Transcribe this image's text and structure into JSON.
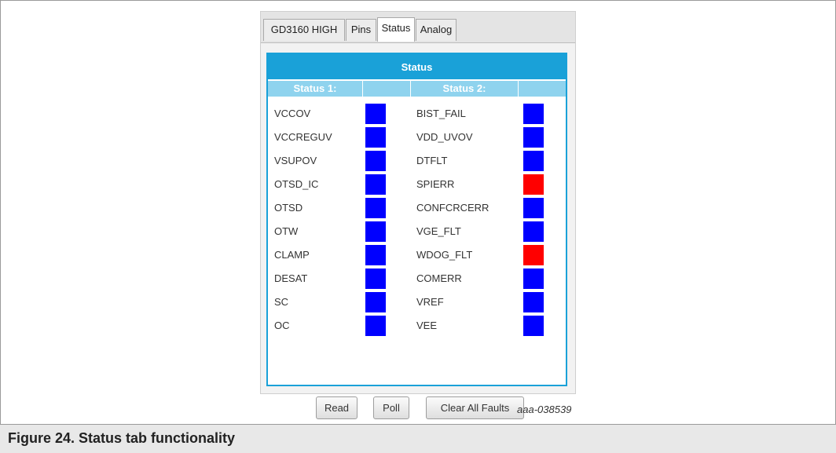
{
  "tabs": [
    {
      "label": "GD3160 HIGH",
      "active": false
    },
    {
      "label": "Pins",
      "active": false
    },
    {
      "label": "Status",
      "active": true
    },
    {
      "label": "Analog",
      "active": false
    }
  ],
  "panel": {
    "title": "Status",
    "col1_header": "Status 1:",
    "col2_header": "Status 2:"
  },
  "status1": [
    {
      "label": "VCCOV",
      "state": "blue"
    },
    {
      "label": "VCCREGUV",
      "state": "blue"
    },
    {
      "label": "VSUPOV",
      "state": "blue"
    },
    {
      "label": "OTSD_IC",
      "state": "blue"
    },
    {
      "label": "OTSD",
      "state": "blue"
    },
    {
      "label": "OTW",
      "state": "blue"
    },
    {
      "label": "CLAMP",
      "state": "blue"
    },
    {
      "label": "DESAT",
      "state": "blue"
    },
    {
      "label": "SC",
      "state": "blue"
    },
    {
      "label": "OC",
      "state": "blue"
    }
  ],
  "status2": [
    {
      "label": "BIST_FAIL",
      "state": "blue"
    },
    {
      "label": "VDD_UVOV",
      "state": "blue"
    },
    {
      "label": "DTFLT",
      "state": "blue"
    },
    {
      "label": "SPIERR",
      "state": "red"
    },
    {
      "label": "CONFCRCERR",
      "state": "blue"
    },
    {
      "label": "VGE_FLT",
      "state": "blue"
    },
    {
      "label": "WDOG_FLT",
      "state": "red"
    },
    {
      "label": "COMERR",
      "state": "blue"
    },
    {
      "label": "VREF",
      "state": "blue"
    },
    {
      "label": "VEE",
      "state": "blue"
    }
  ],
  "buttons": {
    "read": "Read",
    "poll": "Poll",
    "clear": "Clear All Faults"
  },
  "colors": {
    "blue": "#0000ff",
    "red": "#ff0000",
    "accent": "#1aa1d8",
    "header_light": "#8fd3ee"
  },
  "figure": {
    "ref": "aaa-038539",
    "caption": "Figure 24.  Status tab functionality"
  }
}
